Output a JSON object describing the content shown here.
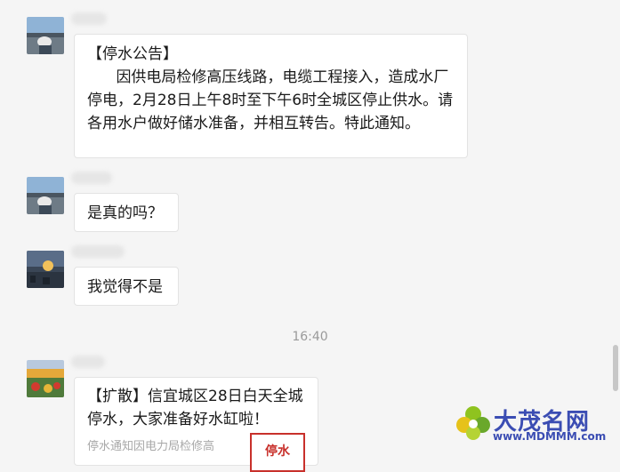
{
  "messages": [
    {
      "title": "【停水公告】",
      "body": "      因供电局检修高压线路，电缆工程接入，造成水厂停电，2月28日上午8时至下午6时全城区停止供水。请各用水户做好储水准备，并相互转告。特此通知。"
    },
    {
      "body": "是真的吗？"
    },
    {
      "body": "我觉得不是"
    }
  ],
  "timestamp": "16:40",
  "shared_card": {
    "title": "【扩散】信宜城区28日白天全城停水，大家准备好水缸啦！",
    "description": "停水通知因电力局检修高",
    "thumb_text": "停水"
  },
  "watermark": {
    "title": "大茂名网",
    "url": "www.MDMMM.com"
  },
  "colors": {
    "background": "#f5f5f5",
    "bubble": "#ffffff",
    "timestamp": "#9a9a9a",
    "watermark": "#3b4db3",
    "thumb_accent": "#c8302b"
  }
}
